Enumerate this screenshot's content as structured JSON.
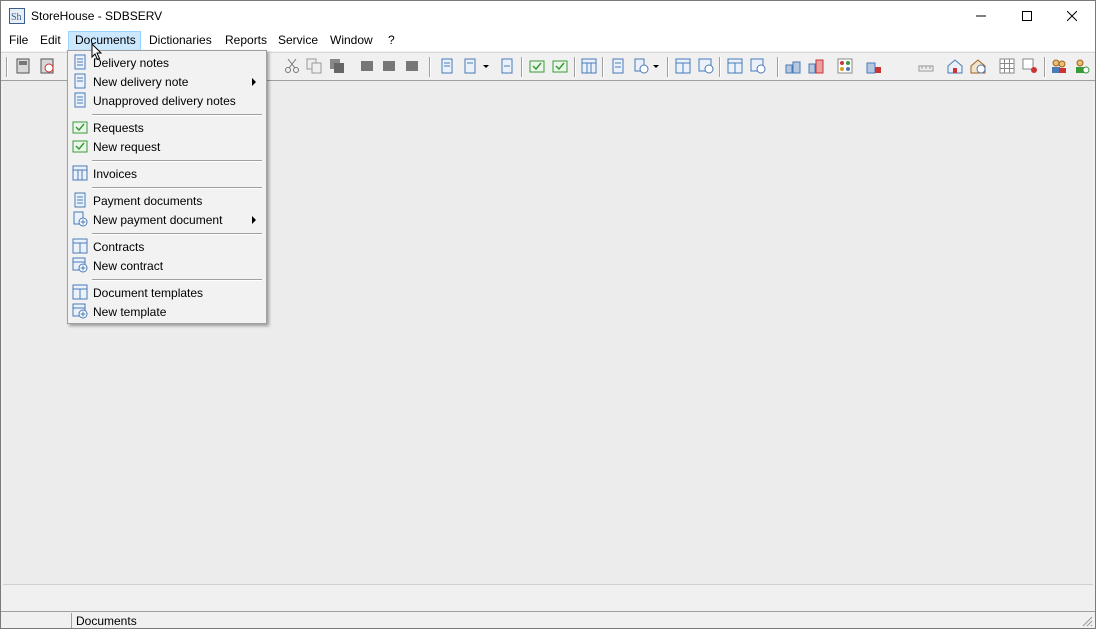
{
  "window": {
    "title": "StoreHouse - SDBSERV",
    "app_icon": "sh-app-icon"
  },
  "window_controls": {
    "minimize": "minimize-icon",
    "maximize": "maximize-icon",
    "close": "close-icon"
  },
  "menubar": {
    "file": "File",
    "edit": "Edit",
    "documents": "Documents",
    "dictionaries": "Dictionaries",
    "reports": "Reports",
    "service": "Service",
    "window": "Window",
    "help": "?"
  },
  "documents_menu": {
    "delivery_notes": "Delivery notes",
    "new_delivery_note": "New delivery note",
    "unapproved_delivery_notes": "Unapproved delivery notes",
    "requests": "Requests",
    "new_request": "New request",
    "invoices": "Invoices",
    "payment_documents": "Payment documents",
    "new_payment_document": "New payment document",
    "contracts": "Contracts",
    "new_contract": "New contract",
    "document_templates": "Document templates",
    "new_template": "New template"
  },
  "statusbar": {
    "text": "Documents"
  },
  "colors": {
    "menu_highlight": "#cce8ff",
    "menu_highlight_border": "#99d1ff",
    "icon_blue": "#4a7ab8",
    "icon_green": "#3a9a3a"
  }
}
